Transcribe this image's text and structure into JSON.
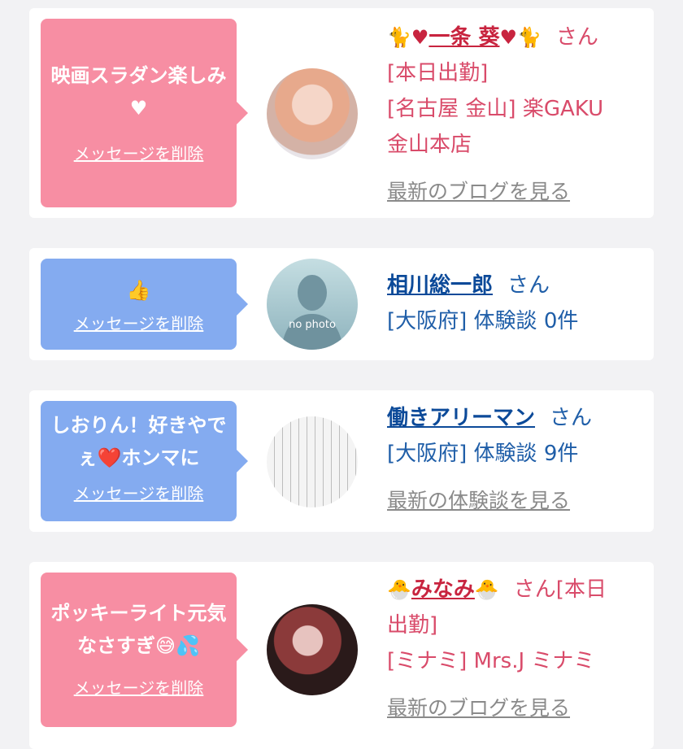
{
  "delete_label": "メッセージを削除",
  "san": "さん",
  "cards": [
    {
      "message": "映画スラダン楽しみ♥",
      "name_prefix_icons": "🐈♥",
      "name": "一条 葵",
      "name_suffix_icons": "♥🐈",
      "san": "さん",
      "line1": "[本日出勤]",
      "line2": "[名古屋 金山] 楽GAKU",
      "line3": "金山本店",
      "more": "最新のブログを見る"
    },
    {
      "message": "👍",
      "name": "相川総一郎",
      "san": "さん",
      "line1": "[大阪府] 体験談 0件",
      "avatar_text": "no photo"
    },
    {
      "message": "しおりん！好きやでぇ❤️ホンマに",
      "name": "働きアリーマン",
      "san": "さん",
      "line1": "[大阪府] 体験談 9件",
      "more": "最新の体験談を見る"
    },
    {
      "message": "ポッキーライト元気なさすぎ😅💦",
      "name_prefix_icons": "🐣",
      "name": "みなみ",
      "name_suffix_icons": "🐣",
      "san": "さん[本日",
      "line1": "出勤]",
      "line2": "[ミナミ] Mrs.J ミナミ",
      "more": "最新のブログを見る"
    }
  ],
  "colors": {
    "pink_bubble": "#f78ea3",
    "blue_bubble": "#84abf0",
    "pink_text": "#d94b6a",
    "blue_text": "#1f5ea8",
    "link_grey": "#8a8a8a"
  }
}
